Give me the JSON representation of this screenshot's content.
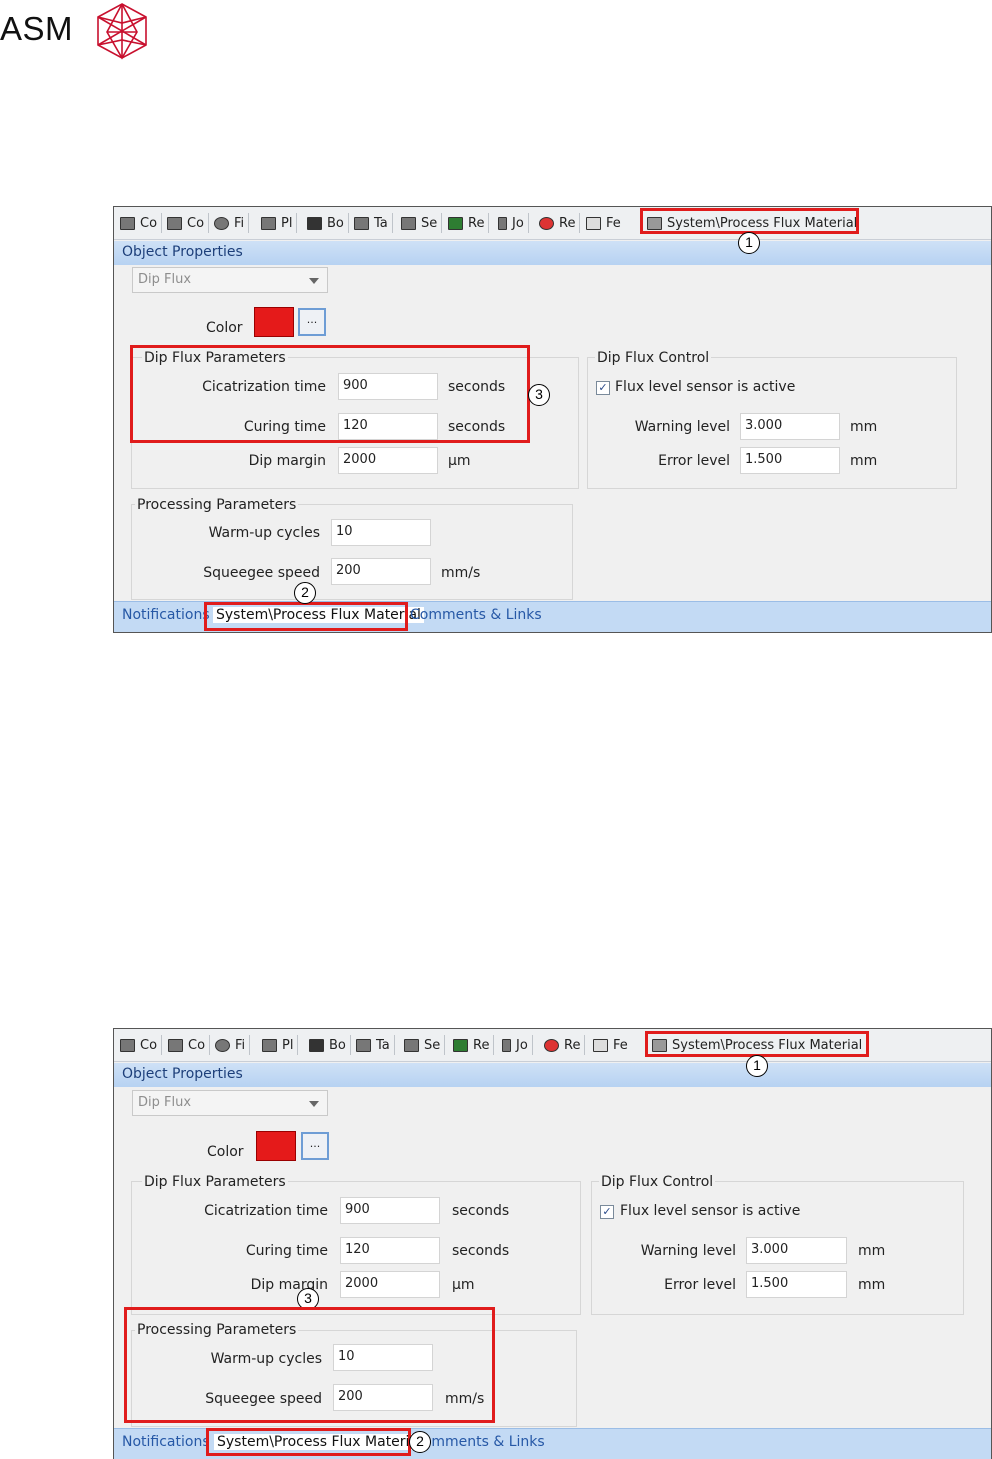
{
  "brand": {
    "name": "ASM",
    "logo_icon": "asm-polyhedron-logo",
    "logo_color": "#c8102e"
  },
  "panel": {
    "tabs": [
      {
        "label": "Co",
        "icon": "monitor-icon"
      },
      {
        "label": "Co",
        "icon": "computer-icon"
      },
      {
        "label": "Fi",
        "icon": "fiducial-icon"
      },
      {
        "label": "Pl",
        "icon": "placement-icon"
      },
      {
        "label": "Bo",
        "icon": "board-icon"
      },
      {
        "label": "Ta",
        "icon": "table-icon"
      },
      {
        "label": "Se",
        "icon": "setup-icon"
      },
      {
        "label": "Re",
        "icon": "recipe-icon"
      },
      {
        "label": "Jo",
        "icon": "job-icon"
      },
      {
        "label": "Re",
        "icon": "reject-icon"
      },
      {
        "label": "Fe",
        "icon": "feeder-icon"
      }
    ],
    "active_tab": {
      "label": "System\\Process Flux Material",
      "icon": "flux-material-icon"
    },
    "header": "Object Properties",
    "dropdown": {
      "value": "Dip Flux"
    },
    "color_label": "Color",
    "color_value": "#e51a1a",
    "color_button": "...",
    "dip_flux_parameters": {
      "title": "Dip Flux Parameters",
      "cicatrization_label": "Cicatrization time",
      "cicatrization_value": "900",
      "cicatrization_unit": "seconds",
      "curing_label": "Curing time",
      "curing_value": "120",
      "curing_unit": "seconds",
      "dip_margin_label": "Dip margin",
      "dip_margin_value": "2000",
      "dip_margin_unit": "µm"
    },
    "dip_flux_control": {
      "title": "Dip Flux Control",
      "sensor_label": "Flux level sensor is active",
      "sensor_checked": true,
      "checkmark": "✓",
      "warning_label": "Warning level",
      "warning_value": "3.000",
      "warning_unit": "mm",
      "error_label": "Error level",
      "error_value": "1.500",
      "error_unit": "mm"
    },
    "processing_parameters": {
      "title": "Processing Parameters",
      "warmup_label": "Warm-up cycles",
      "warmup_value": "10",
      "squeegee_label": "Squeegee speed",
      "squeegee_value": "200",
      "squeegee_unit": "mm/s"
    },
    "footer_tabs": [
      "Notifications",
      "System\\Process Flux Material",
      "Comments & Links"
    ]
  },
  "callouts": [
    "1",
    "2",
    "3"
  ],
  "callout_color": "#e01c1c"
}
